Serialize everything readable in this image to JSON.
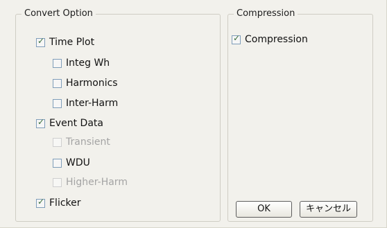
{
  "convert_option": {
    "title": "Convert Option",
    "time_plot": {
      "label": "Time Plot",
      "checked": true
    },
    "integ_wh": {
      "label": "Integ Wh",
      "checked": false
    },
    "harmonics": {
      "label": "Harmonics",
      "checked": false
    },
    "inter_harm": {
      "label": "Inter-Harm",
      "checked": false
    },
    "event_data": {
      "label": "Event Data",
      "checked": true
    },
    "transient": {
      "label": "Transient",
      "checked": false,
      "disabled": true
    },
    "wdu": {
      "label": "WDU",
      "checked": false
    },
    "higher_harm": {
      "label": "Higher-Harm",
      "checked": false,
      "disabled": true
    },
    "flicker": {
      "label": "Flicker",
      "checked": true
    }
  },
  "compression": {
    "title": "Compression",
    "compression": {
      "label": "Compression",
      "checked": true
    }
  },
  "buttons": {
    "ok": "OK",
    "cancel": "キャンセル"
  },
  "check_glyph": "✓",
  "colors": {
    "dialog_bg": "#f2f1ec",
    "checkbox_border": "#7f9db9",
    "checkmark": "#3a6e3a",
    "disabled_text": "#a4a4a4"
  }
}
